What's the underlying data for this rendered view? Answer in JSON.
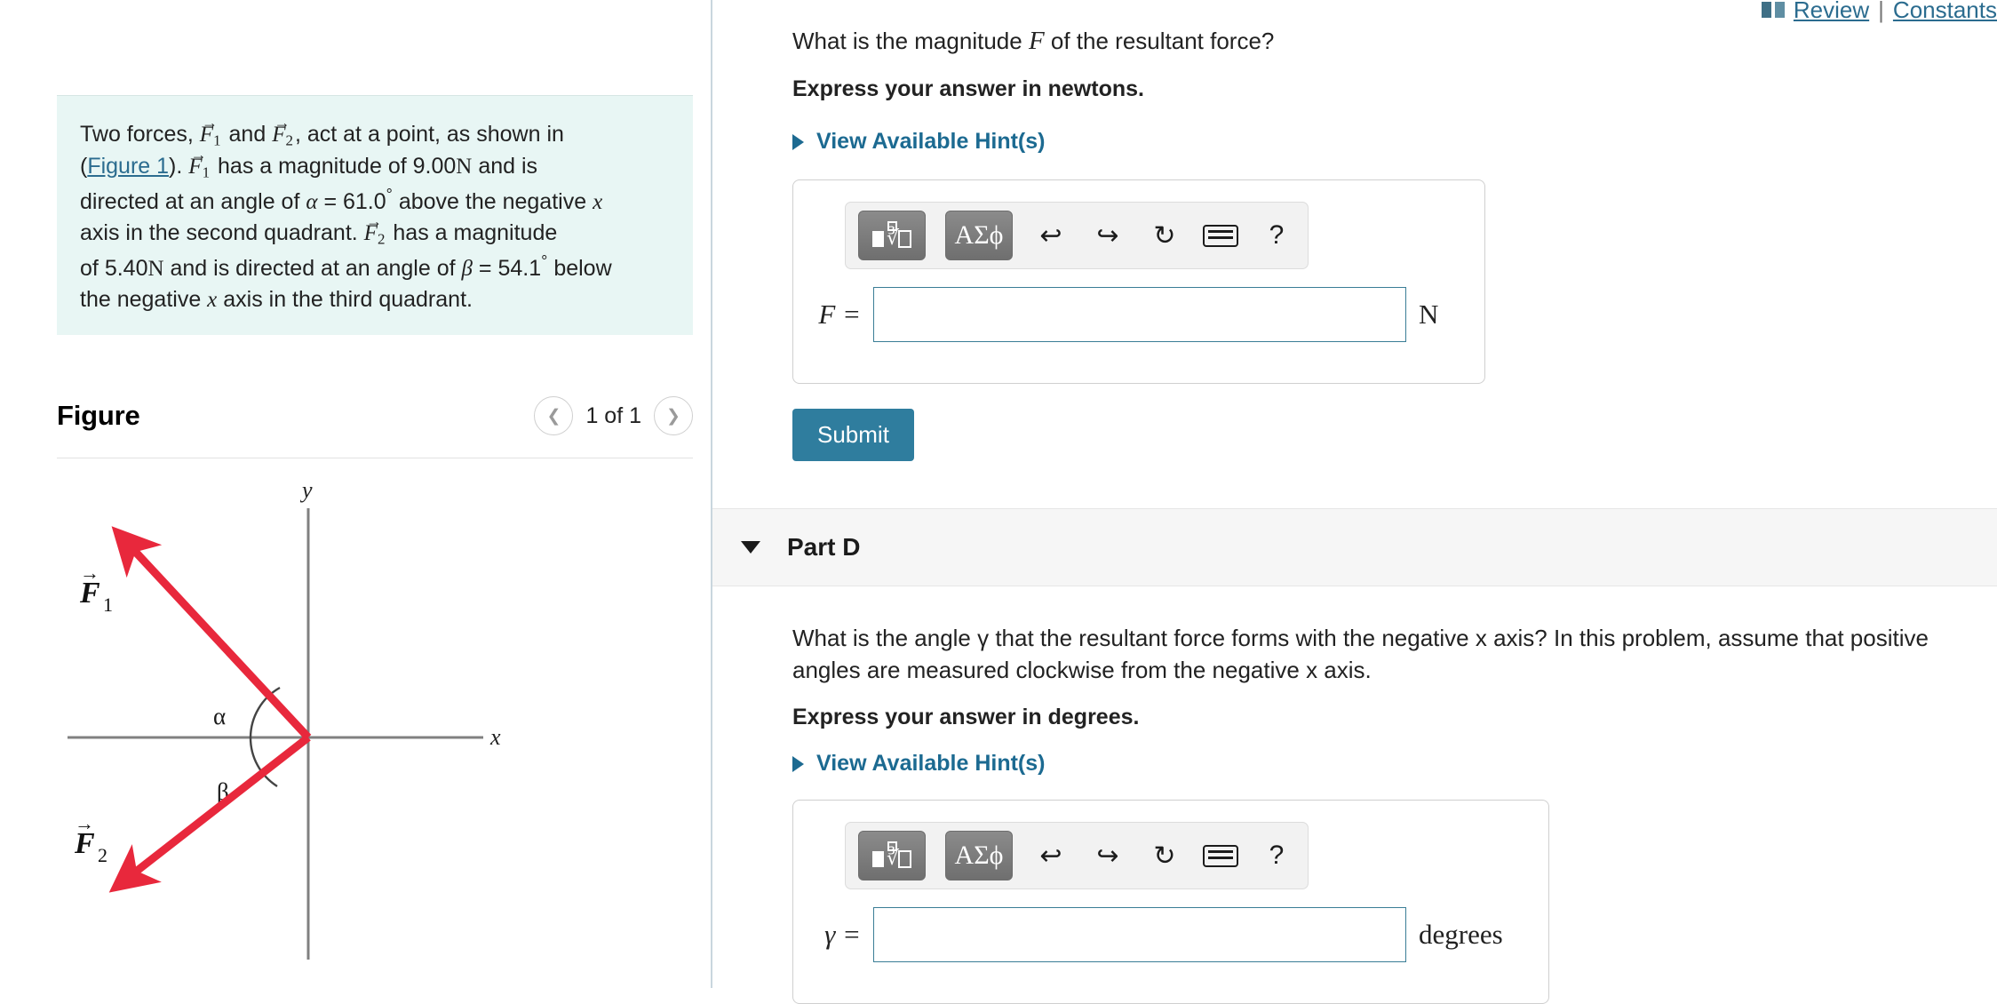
{
  "topbar": {
    "book_icon": "book-icon",
    "review": "Review",
    "separator": "|",
    "constants": "Constants"
  },
  "problem": {
    "line1_a": "Two forces,",
    "f1": "F",
    "f1_sub": "1",
    "and": "and",
    "f2": "F",
    "f2_sub": "2",
    "line1_b": ", act at a point, as shown in",
    "paren_open": "(",
    "figure_link": "Figure 1",
    "paren_close": ").",
    "has_magnitude_of": "has a magnitude of",
    "f1_magnitude": "9.00",
    "f1_unit": "N",
    "and_is": "and is",
    "directed_at": "directed at an angle of",
    "alpha": "α",
    "eq": "=",
    "alpha_value": "61.0",
    "degree": "°",
    "above_the_negative": "above the negative",
    "x": "x",
    "axis_second_quadrant": "axis in the second quadrant.",
    "has_a_magnitude": "has a magnitude",
    "of": "of",
    "f2_magnitude": "5.40",
    "f2_unit": "N",
    "and_directed": "and is directed at an angle of",
    "beta": "β",
    "beta_value": "54.1",
    "below": "below",
    "the_negative": "the negative",
    "axis_third_quadrant": "axis in the third quadrant."
  },
  "figure": {
    "title": "Figure",
    "prev_icon": "chevron-left-icon",
    "next_icon": "chevron-right-icon",
    "page_count": "1 of 1",
    "diagram": {
      "y_label": "y",
      "x_label": "x",
      "f1_label": "F",
      "f1_sub": "1",
      "f2_label": "F",
      "f2_sub": "2",
      "alpha_label": "α",
      "beta_label": "β",
      "vector_color": "#e8283c",
      "axis_color": "#808080"
    }
  },
  "partC": {
    "question": "What is the magnitude  F  of the resultant force?",
    "question_pre": "What is the magnitude",
    "question_var": "F",
    "question_post": "of the resultant force?",
    "express": "Express your answer in newtons.",
    "hints_label": "View Available Hint(s)",
    "hints_icon": "triangle-right-icon",
    "toolbar": {
      "template_icon": "math-template-icon",
      "greek_icon": "ΑΣϕ",
      "undo_icon": "undo-arrow-icon",
      "redo_icon": "redo-arrow-icon",
      "reset_icon": "reset-circle-icon",
      "keyboard_icon": "keyboard-icon",
      "help_icon": "?"
    },
    "answer_var": "F",
    "answer_eq": "=",
    "answer_value": "",
    "answer_placeholder": "",
    "unit": "N",
    "submit_label": "Submit"
  },
  "partD": {
    "caret_icon": "caret-down-icon",
    "title": "Part D",
    "question_line1": "What is the angle γ that the resultant force forms with the negative x axis? In this problem, assume that positive",
    "question_line2": "angles are measured  clockwise from the negative x axis.",
    "express": "Express your answer in degrees.",
    "hints_label": "View Available Hint(s)",
    "hints_icon": "triangle-right-icon",
    "toolbar": {
      "template_icon": "math-template-icon",
      "greek_icon": "ΑΣϕ",
      "undo_icon": "undo-arrow-icon",
      "redo_icon": "redo-arrow-icon",
      "reset_icon": "reset-circle-icon",
      "keyboard_icon": "keyboard-icon",
      "help_icon": "?"
    },
    "answer_var": "γ",
    "answer_eq": "=",
    "answer_value": "",
    "answer_placeholder": "",
    "unit": "degrees"
  },
  "colors": {
    "accent": "#2f7d9e",
    "link": "#2b6c8f",
    "problem_bg": "#e8f6f4",
    "vector": "#e8283c"
  }
}
